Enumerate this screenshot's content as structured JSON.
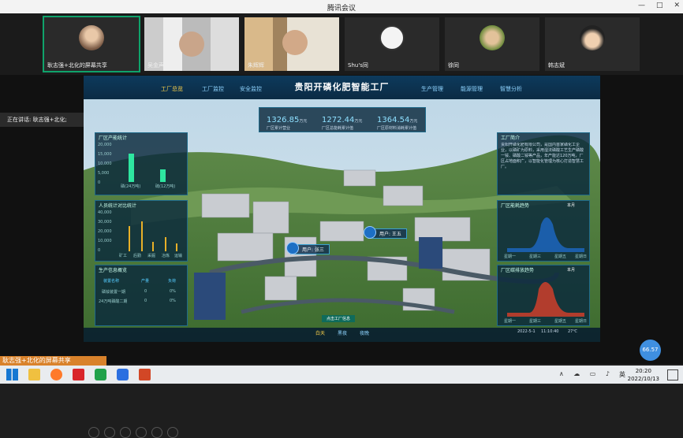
{
  "window": {
    "title": "腾讯会议",
    "controls": [
      "—",
      "□",
      "✕"
    ]
  },
  "participants": [
    {
      "name": "耿志强+北化的屏幕共享",
      "active": true,
      "avatar_color": "#8a6a5a"
    },
    {
      "name": "吴金声",
      "active": false,
      "avatar_color": ""
    },
    {
      "name": "朱辉辉",
      "active": false,
      "avatar_color": ""
    },
    {
      "name": "Shu's同",
      "active": false,
      "avatar_color": "#f0f0f0"
    },
    {
      "name": "徐同",
      "active": false,
      "avatar_color": "#c8a060"
    },
    {
      "name": "韩志斌",
      "active": false,
      "avatar_color": "#f8f8f8"
    }
  ],
  "speaker_label": "正在讲话: 耿志强+北化;",
  "share_label": "耿志强+北化的屏幕共享",
  "timer": "66.57",
  "dashboard": {
    "title": "贵阳开磷化肥智能工厂",
    "nav_left": [
      "工厂总览",
      "工厂监控",
      "安全监控"
    ],
    "nav_right": [
      "生产管理",
      "能源管理",
      "智慧分析"
    ],
    "kpis": [
      {
        "value": "1326.85",
        "unit": "万元",
        "label": "厂区累计营业"
      },
      {
        "value": "1272.44",
        "unit": "万元",
        "label": "厂区总能耗累计值"
      },
      {
        "value": "1364.54",
        "unit": "万元",
        "label": "厂区原材料消耗累计值"
      }
    ],
    "panel1": {
      "title": "厂区产能统计",
      "yticks": [
        "20,000",
        "15,000",
        "10,000",
        "5,000",
        "0"
      ],
      "bars": [
        {
          "label": "磷(24万吨)",
          "value": 16000
        },
        {
          "label": "硫(12万吨)",
          "value": 7000
        }
      ]
    },
    "panel2": {
      "title": "人员统计对比统计",
      "yticks": [
        "40,000",
        "30,000",
        "20,000",
        "10,000",
        "0"
      ],
      "cats": [
        "矿工",
        "后勤",
        "采掘",
        "冶炼",
        "运输"
      ]
    },
    "panel3": {
      "title": "生产信息概览",
      "headers": [
        "装置名称",
        "产量",
        "负荷"
      ],
      "rows": [
        [
          "磷铵装置一期",
          "0",
          "0%"
        ],
        [
          "24万吨磷酸二期",
          "0",
          "0%"
        ]
      ]
    },
    "intro_title": "工厂简介",
    "intro_text": "贵阳开磷化肥有限公司，是国内首家磷化工企业，以磷矿为原料，采用湿法磷酸工艺生产磷酸一铵、磷酸二铵等产品，年产能达120万吨，厂区占地面积广，以智能化管理为核心打造智慧工厂。",
    "chart_r1": {
      "title": "厂区能耗趋势",
      "tag": "本月",
      "xlabels": [
        "星期一",
        "星期三",
        "星期五",
        "星期日"
      ]
    },
    "chart_r2": {
      "title": "厂区碳排放趋势",
      "tag": "本月",
      "xlabels": [
        "星期一",
        "星期三",
        "星期五",
        "星期日"
      ]
    },
    "pins": [
      {
        "label": "用户: 张三"
      },
      {
        "label": "用户: 王五"
      }
    ],
    "bottom_tabs": [
      "白天",
      "黑夜",
      "夜晚"
    ],
    "status": {
      "date": "2022-5-1",
      "time": "11:10:40",
      "temp": "27℃"
    },
    "legend_btn": "点击工厂信息"
  },
  "taskbar": {
    "time": "20:20",
    "date": "2022/10/13",
    "lang": "英",
    "tray": "∧ ☁ ▭ ♪"
  }
}
